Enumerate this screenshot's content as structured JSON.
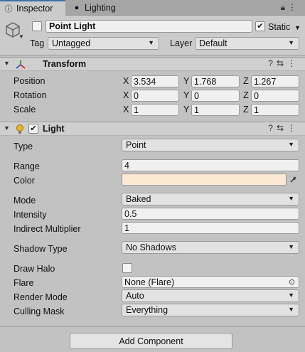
{
  "tabs": [
    {
      "label": "Inspector",
      "icon": "info-icon",
      "active": true
    },
    {
      "label": "Lighting",
      "icon": "bulb-icon",
      "active": false
    }
  ],
  "header": {
    "active_checked": false,
    "name": "Point Light",
    "static_checked": true,
    "static_label": "Static",
    "tag_label": "Tag",
    "tag_value": "Untagged",
    "layer_label": "Layer",
    "layer_value": "Default"
  },
  "transform": {
    "title": "Transform",
    "rows": [
      {
        "label": "Position",
        "x": "3.534",
        "y": "1.768",
        "z": "1.267"
      },
      {
        "label": "Rotation",
        "x": "0",
        "y": "0",
        "z": "0"
      },
      {
        "label": "Scale",
        "x": "1",
        "y": "1",
        "z": "1"
      }
    ],
    "axis": {
      "x": "X",
      "y": "Y",
      "z": "Z"
    }
  },
  "light": {
    "title": "Light",
    "enabled": true,
    "type_label": "Type",
    "type_value": "Point",
    "range_label": "Range",
    "range_value": "4",
    "color_label": "Color",
    "color_value": "#fbe9d3",
    "mode_label": "Mode",
    "mode_value": "Baked",
    "intensity_label": "Intensity",
    "intensity_value": "0.5",
    "indirect_label": "Indirect Multiplier",
    "indirect_value": "1",
    "shadow_label": "Shadow Type",
    "shadow_value": "No Shadows",
    "halo_label": "Draw Halo",
    "halo_checked": false,
    "flare_label": "Flare",
    "flare_value": "None (Flare)",
    "render_label": "Render Mode",
    "render_value": "Auto",
    "culling_label": "Culling Mask",
    "culling_value": "Everything"
  },
  "footer": {
    "add_component_label": "Add Component"
  },
  "colors": {
    "accent": "#3a72b0",
    "panel": "#c2c2c2",
    "header": "#cfcfcf"
  }
}
